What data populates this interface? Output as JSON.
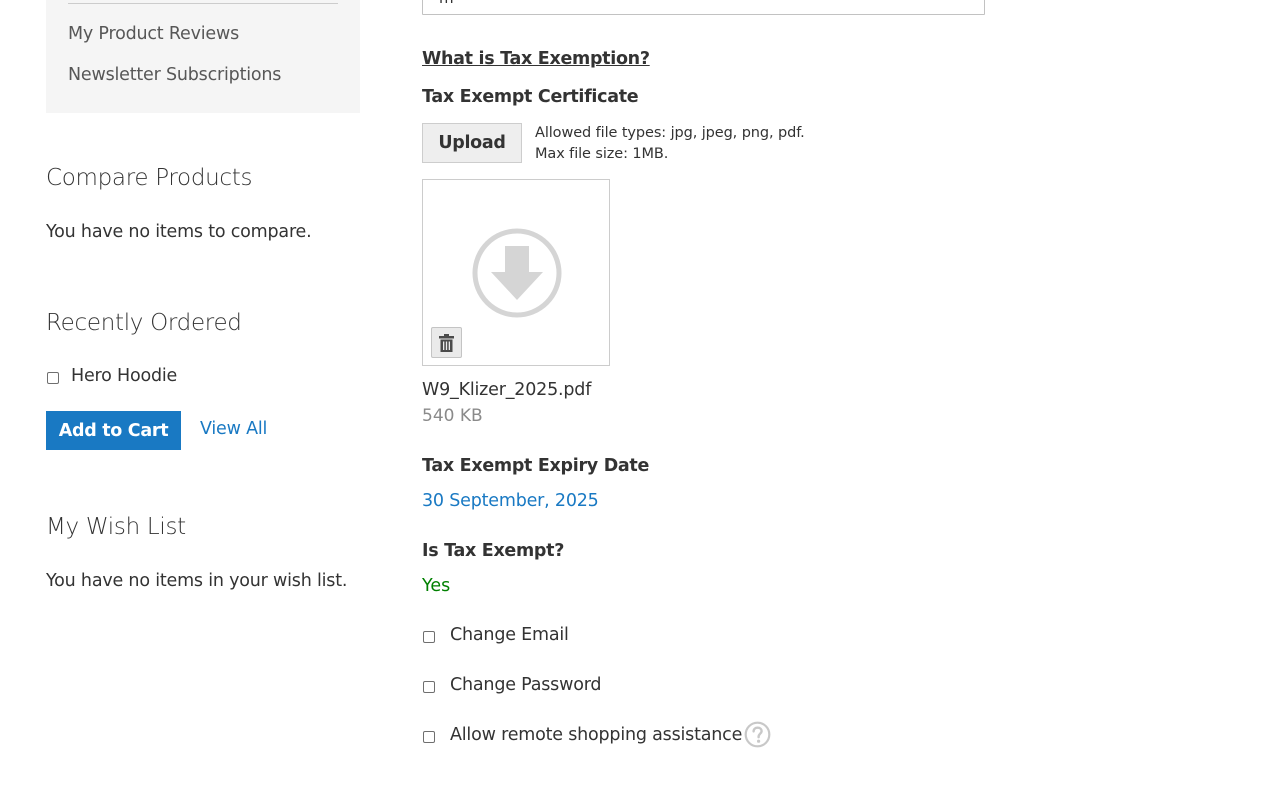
{
  "sidebar": {
    "nav_links": [
      "My Product Reviews",
      "Newsletter Subscriptions"
    ],
    "compare": {
      "title": "Compare Products",
      "empty_text": "You have no items to compare."
    },
    "recently_ordered": {
      "title": "Recently Ordered",
      "items": [
        {
          "name": "Hero Hoodie",
          "checked": false
        }
      ],
      "add_to_cart_label": "Add to Cart",
      "view_all_label": "View All"
    },
    "wishlist": {
      "title": "My Wish List",
      "empty_text": "You have no items in your wish list."
    }
  },
  "main": {
    "top_input_value": "m",
    "tax_exemption_link": "What is Tax Exemption?",
    "certificate": {
      "label": "Tax Exempt Certificate",
      "upload_label": "Upload",
      "allowed_types": "Allowed file types: jpg, jpeg, png, pdf.",
      "max_size": "Max file size: 1MB.",
      "file_name": "W9_Klizer_2025.pdf",
      "file_size": "540 KB"
    },
    "expiry": {
      "label": "Tax Exempt Expiry Date",
      "value": "30 September, 2025"
    },
    "exempt": {
      "label": "Is Tax Exempt?",
      "value": "Yes"
    },
    "options": [
      {
        "label": "Change Email",
        "checked": false
      },
      {
        "label": "Change Password",
        "checked": false
      },
      {
        "label": "Allow remote shopping assistance",
        "checked": false
      }
    ]
  },
  "colors": {
    "link": "#1979c3",
    "primary_button": "#1979c3",
    "success": "#008000",
    "sidebar_bg": "#f5f5f5"
  },
  "icons": [
    "download-icon",
    "trash-icon",
    "help-icon"
  ]
}
